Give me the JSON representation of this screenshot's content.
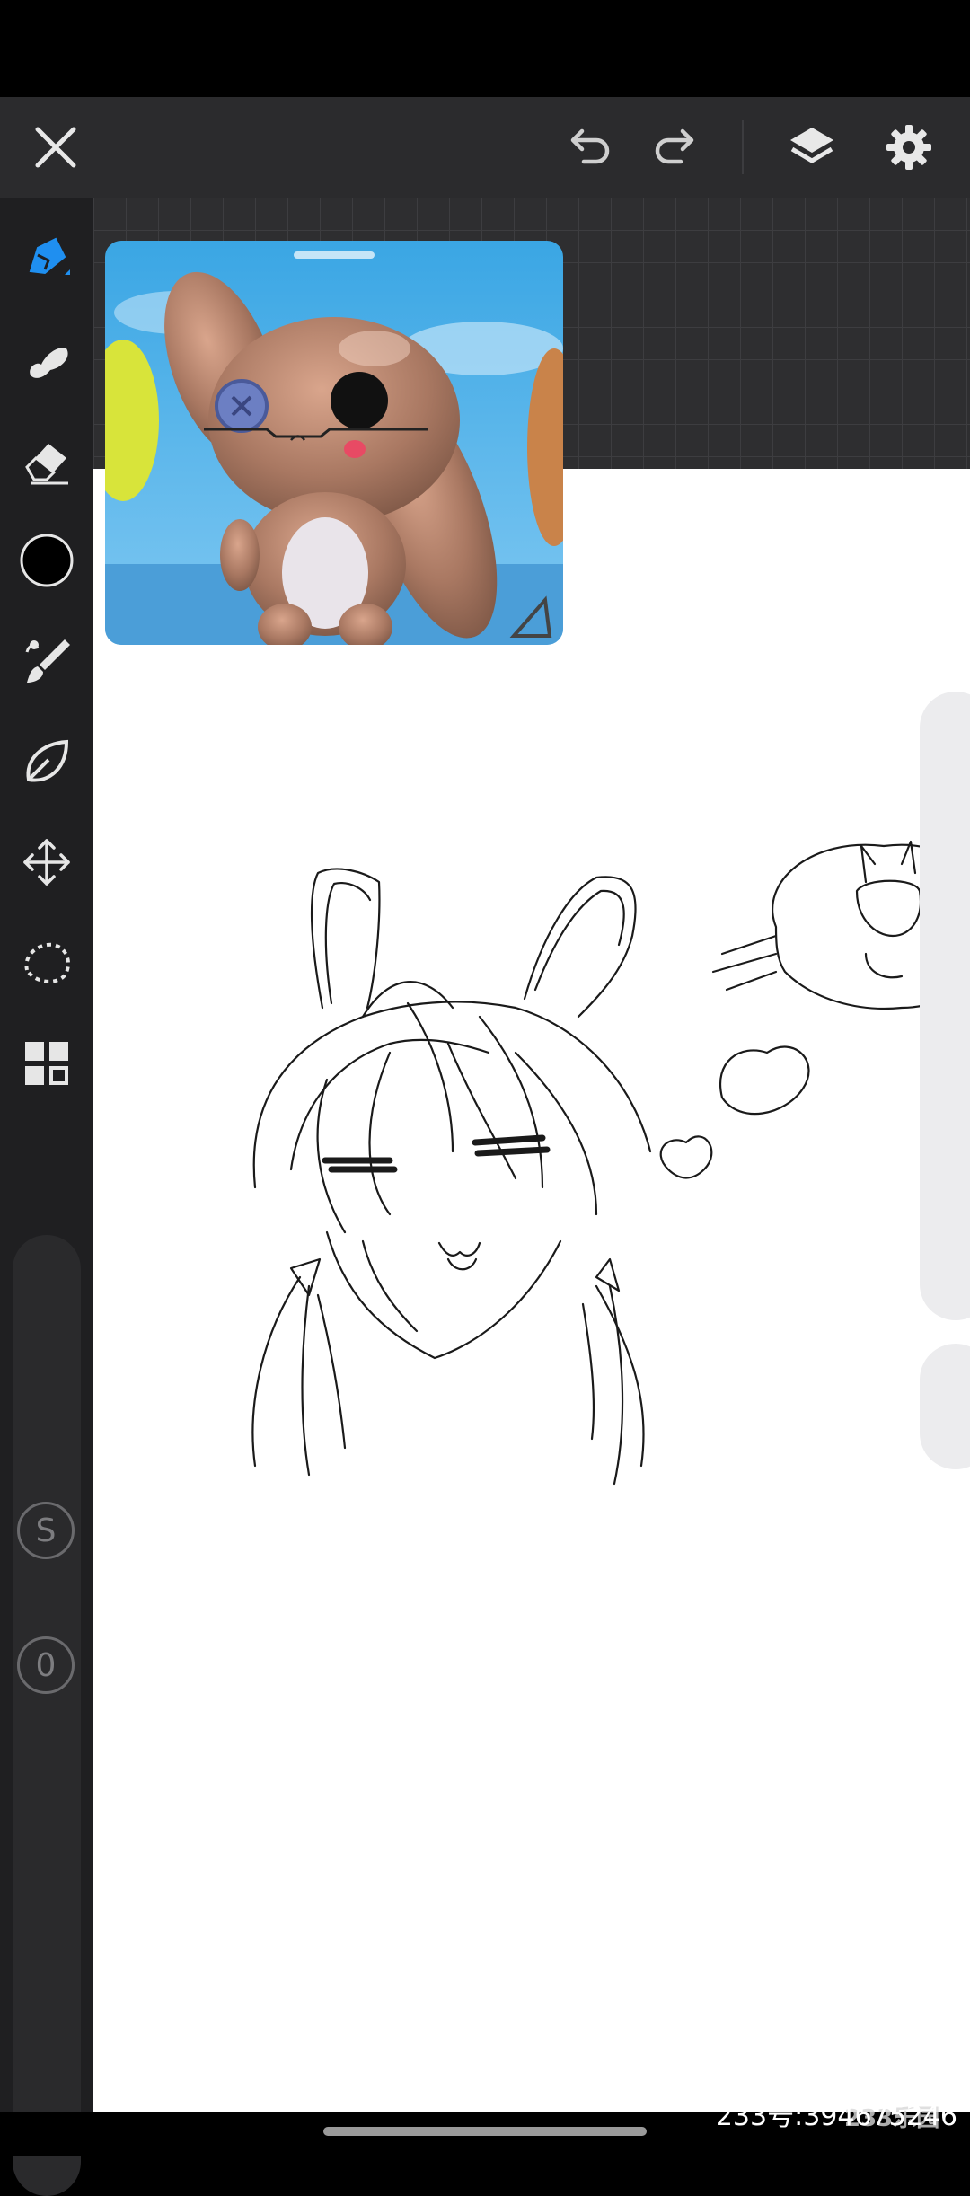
{
  "app": {
    "colors": {
      "accent": "#1f8ff0",
      "toolbar_bg": "#1f1f21",
      "topbar_bg": "#2b2b2d",
      "paper": "#ffffff"
    }
  },
  "top_bar": {
    "icons": [
      "close-icon",
      "undo-icon",
      "redo-icon",
      "layers-icon",
      "settings-icon"
    ]
  },
  "toolbar": {
    "tools": [
      "pen-icon",
      "smudge-icon",
      "eraser-icon",
      "color-swatch",
      "brush-icon",
      "fill-shape-icon",
      "transform-icon",
      "lasso-selection-icon",
      "grid-menu-icon"
    ],
    "selected_tool": "pen-icon",
    "current_color": "#000000",
    "size_label": "S",
    "opacity_label": "0"
  },
  "watermark": {
    "logo": "233乐园",
    "id_text": "233号:394675246"
  }
}
